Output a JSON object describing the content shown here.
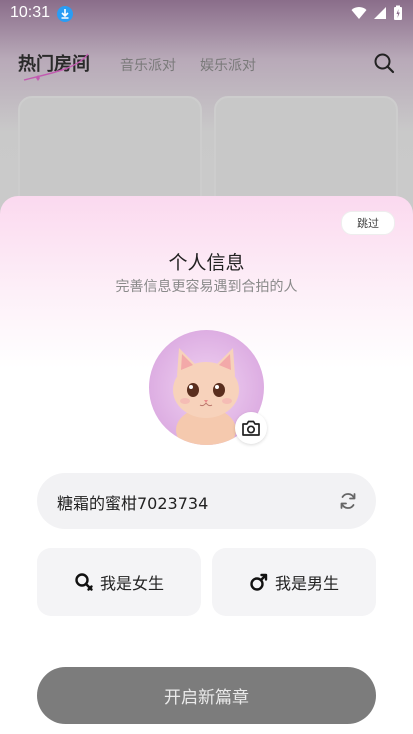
{
  "status_bar": {
    "time": "10:31"
  },
  "background": {
    "tabs": {
      "hot": "热门房间",
      "music": "音乐派对",
      "entertainment": "娱乐派对"
    }
  },
  "sheet": {
    "skip_label": "跳过",
    "title": "个人信息",
    "subtitle": "完善信息更容易遇到合拍的人",
    "nickname": "糖霜的蜜柑7023734",
    "female_label": "我是女生",
    "male_label": "我是男生",
    "start_label": "开启新篇章"
  },
  "colors": {
    "accent_primary_button": "#7c7c7c",
    "sheet_top_tint": "#fbd9ef"
  }
}
